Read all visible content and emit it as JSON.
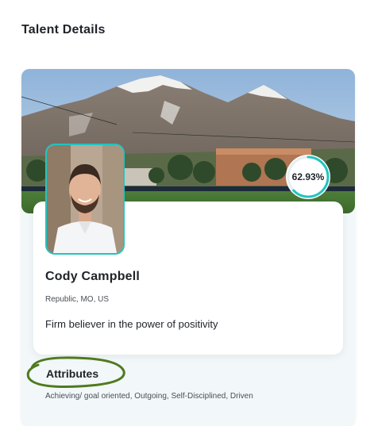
{
  "page": {
    "section_title": "Talent Details"
  },
  "profile": {
    "name": "Cody Campbell",
    "location": "Republic, MO, US",
    "tagline": "Firm believer in the power of positivity",
    "match_score_label": "62.93%",
    "match_score_fraction": 0.6293
  },
  "attributes": {
    "title": "Attributes",
    "values": "Achieving/ goal oriented, Outgoing, Self-Disciplined, Driven"
  },
  "colors": {
    "accent": "#21c4c0",
    "annotation_circle": "#4f7a1e",
    "card_background": "#f2f7f9"
  }
}
